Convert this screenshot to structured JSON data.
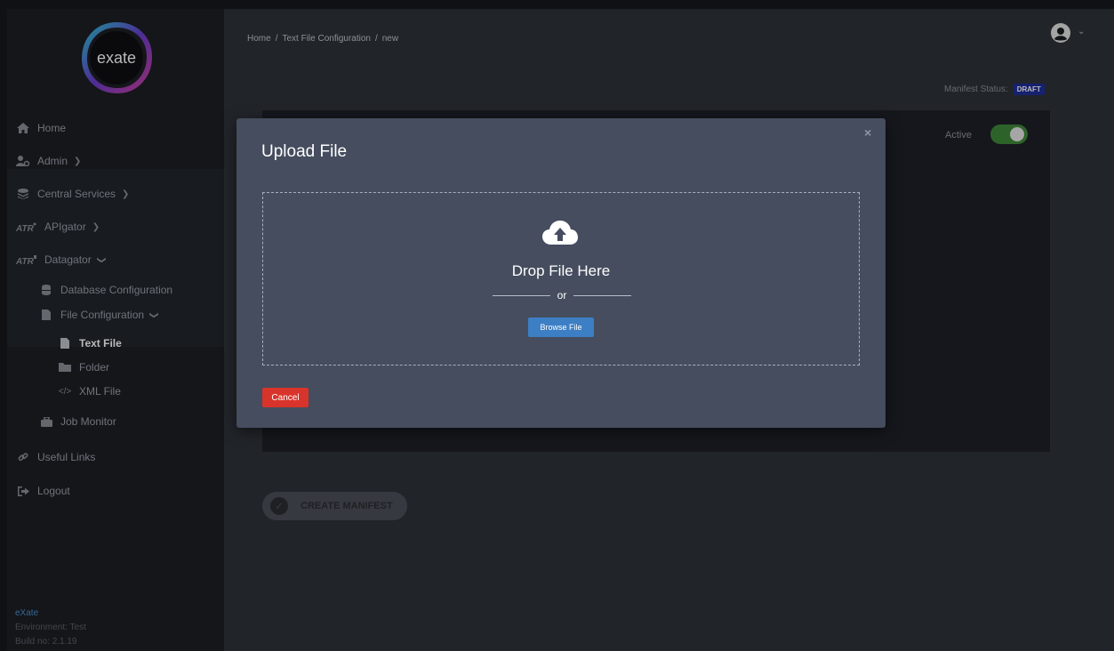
{
  "brand": {
    "logo_text": "exate"
  },
  "sidebar": {
    "items": [
      {
        "label": "Home",
        "icon": "home-icon"
      },
      {
        "label": "Admin",
        "icon": "admin-icon",
        "has_chevron": true
      },
      {
        "label": "Central Services",
        "icon": "database-stack-icon",
        "has_chevron": true
      },
      {
        "label": "APIgator",
        "icon": "apigator-icon",
        "has_chevron": true
      },
      {
        "label": "Datagator",
        "icon": "datagator-icon",
        "expanded": true
      },
      {
        "label": "Database Configuration",
        "icon": "database-icon"
      },
      {
        "label": "File Configuration",
        "icon": "file-icon",
        "expanded": true
      },
      {
        "label": "Text File",
        "icon": "file-icon",
        "active": true
      },
      {
        "label": "Folder",
        "icon": "folder-icon"
      },
      {
        "label": "XML File",
        "icon": "code-icon"
      },
      {
        "label": "Job Monitor",
        "icon": "briefcase-icon"
      },
      {
        "label": "Useful Links",
        "icon": "link-icon"
      },
      {
        "label": "Logout",
        "icon": "logout-icon"
      }
    ],
    "footer": {
      "brand": "eXate",
      "environment": "Environment: Test",
      "build": "Build no: 2.1.19"
    }
  },
  "header": {
    "breadcrumb": [
      "Home",
      "Text File Configuration",
      "new"
    ],
    "breadcrumb_sep": "/",
    "manifest_status_label": "Manifest Status:",
    "manifest_status_value": "DRAFT"
  },
  "card": {
    "active_label": "Active",
    "active_on": true
  },
  "actions": {
    "create_manifest": "CREATE MANIFEST"
  },
  "modal": {
    "title": "Upload File",
    "close": "×",
    "drop_text": "Drop File Here",
    "or_text": "or",
    "browse_label": "Browse File",
    "cancel_label": "Cancel"
  },
  "colors": {
    "accent_blue": "#3d7fc4",
    "danger_red": "#d9342b",
    "toggle_green": "#3f8a39",
    "badge_blue": "#1f2f9c"
  }
}
